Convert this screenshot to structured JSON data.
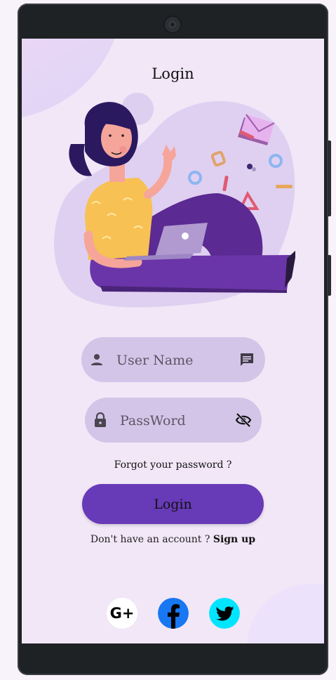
{
  "header": {
    "title": "Login"
  },
  "form": {
    "username_placeholder": "User Name",
    "password_placeholder": "PassWord",
    "forgot_text": "Forgot your password ?",
    "login_label": "Login"
  },
  "signup": {
    "prompt": "Don't have an account ? ",
    "link": "Sign up"
  },
  "social": {
    "google_label": "G+",
    "icons": [
      "google-plus-icon",
      "facebook-icon",
      "twitter-icon"
    ]
  },
  "colors": {
    "background": "#f1e7f7",
    "field": "#d3c5e8",
    "primary": "#673ab7",
    "facebook": "#1877f2",
    "twitter": "#00e5ff"
  }
}
